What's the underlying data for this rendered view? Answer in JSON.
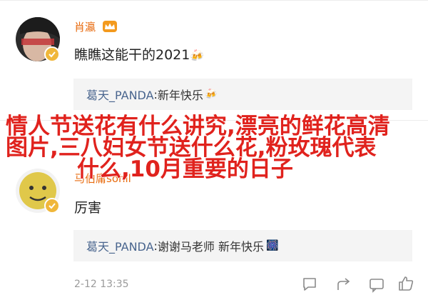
{
  "comment1": {
    "username": "肖瀛",
    "crown_icon": "crown-icon",
    "text": "瞧瞧这能干的2021",
    "text_emoji": "🍻",
    "reply": {
      "user": "葛天_PANDA",
      "sep": ": ",
      "text": "新年快乐",
      "emoji": "🍻"
    }
  },
  "comment2": {
    "username": "马伯庸sohil",
    "text": "厉害",
    "reply": {
      "user": "葛天_PANDA",
      "sep": ": ",
      "text": "谢谢马老师 新年快乐",
      "emoji": "🎆"
    },
    "timestamp": "2-12 13:35"
  },
  "overlay": {
    "line1": "情人节送花有什么讲究,漂亮的鲜花高清",
    "line2": "图片,三八妇女节送什么花,粉玫瑰代表",
    "line3": "什么,10月重要的日子"
  },
  "actions": {
    "icons": [
      "chat-bubble-icon",
      "share-icon",
      "comment-icon",
      "like-icon"
    ]
  },
  "colors": {
    "username": "#e86b0f",
    "reply_user": "#49658e",
    "overlay_text": "#e0221d",
    "badge": "#f0b73a"
  }
}
